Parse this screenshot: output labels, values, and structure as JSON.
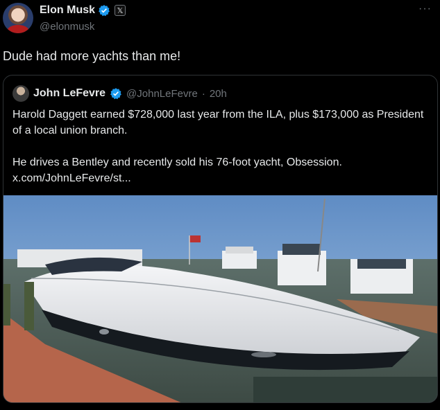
{
  "tweet": {
    "author_name": "Elon Musk",
    "author_handle": "@elonmusk",
    "badge_icon": "x-logo-icon",
    "more_label": "···",
    "text": "Dude had more yachts than me!"
  },
  "quoted": {
    "author_name": "John LeFevre",
    "author_handle": "@JohnLeFevre",
    "separator": "·",
    "time": "20h",
    "line1": "Harold Daggett earned $728,000 last year from the ILA, plus $173,000 as President of a local union branch.",
    "line2": "He drives a Bentley and recently sold his 76-foot yacht, Obsession.",
    "link": "x.com/JohnLeFevre/st..."
  },
  "colors": {
    "background": "#000000",
    "text": "#e7e9ea",
    "muted": "#71767b",
    "verified": "#1d9bf0",
    "border": "#2f3336"
  }
}
